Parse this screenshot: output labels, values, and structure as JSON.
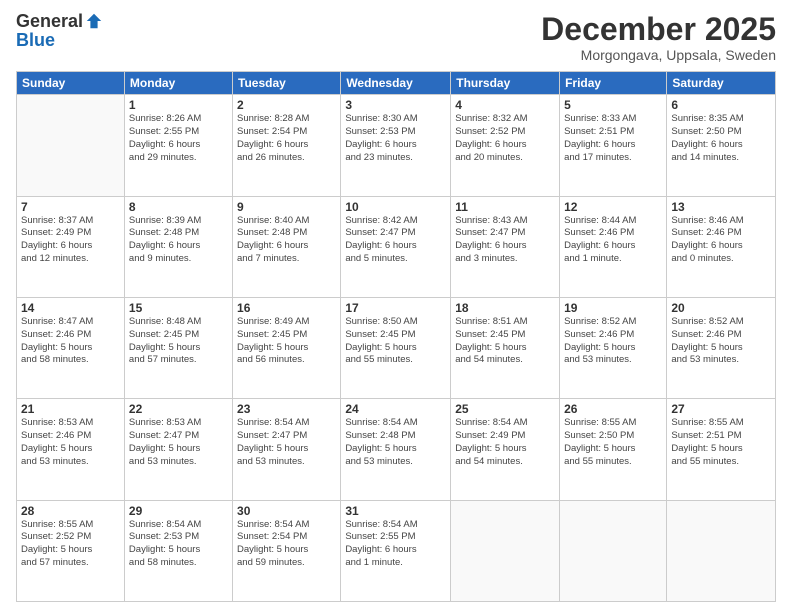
{
  "logo": {
    "general": "General",
    "blue": "Blue"
  },
  "title": "December 2025",
  "subtitle": "Morgongava, Uppsala, Sweden",
  "headers": [
    "Sunday",
    "Monday",
    "Tuesday",
    "Wednesday",
    "Thursday",
    "Friday",
    "Saturday"
  ],
  "weeks": [
    [
      {
        "day": "",
        "info": ""
      },
      {
        "day": "1",
        "info": "Sunrise: 8:26 AM\nSunset: 2:55 PM\nDaylight: 6 hours\nand 29 minutes."
      },
      {
        "day": "2",
        "info": "Sunrise: 8:28 AM\nSunset: 2:54 PM\nDaylight: 6 hours\nand 26 minutes."
      },
      {
        "day": "3",
        "info": "Sunrise: 8:30 AM\nSunset: 2:53 PM\nDaylight: 6 hours\nand 23 minutes."
      },
      {
        "day": "4",
        "info": "Sunrise: 8:32 AM\nSunset: 2:52 PM\nDaylight: 6 hours\nand 20 minutes."
      },
      {
        "day": "5",
        "info": "Sunrise: 8:33 AM\nSunset: 2:51 PM\nDaylight: 6 hours\nand 17 minutes."
      },
      {
        "day": "6",
        "info": "Sunrise: 8:35 AM\nSunset: 2:50 PM\nDaylight: 6 hours\nand 14 minutes."
      }
    ],
    [
      {
        "day": "7",
        "info": "Sunrise: 8:37 AM\nSunset: 2:49 PM\nDaylight: 6 hours\nand 12 minutes."
      },
      {
        "day": "8",
        "info": "Sunrise: 8:39 AM\nSunset: 2:48 PM\nDaylight: 6 hours\nand 9 minutes."
      },
      {
        "day": "9",
        "info": "Sunrise: 8:40 AM\nSunset: 2:48 PM\nDaylight: 6 hours\nand 7 minutes."
      },
      {
        "day": "10",
        "info": "Sunrise: 8:42 AM\nSunset: 2:47 PM\nDaylight: 6 hours\nand 5 minutes."
      },
      {
        "day": "11",
        "info": "Sunrise: 8:43 AM\nSunset: 2:47 PM\nDaylight: 6 hours\nand 3 minutes."
      },
      {
        "day": "12",
        "info": "Sunrise: 8:44 AM\nSunset: 2:46 PM\nDaylight: 6 hours\nand 1 minute."
      },
      {
        "day": "13",
        "info": "Sunrise: 8:46 AM\nSunset: 2:46 PM\nDaylight: 6 hours\nand 0 minutes."
      }
    ],
    [
      {
        "day": "14",
        "info": "Sunrise: 8:47 AM\nSunset: 2:46 PM\nDaylight: 5 hours\nand 58 minutes."
      },
      {
        "day": "15",
        "info": "Sunrise: 8:48 AM\nSunset: 2:45 PM\nDaylight: 5 hours\nand 57 minutes."
      },
      {
        "day": "16",
        "info": "Sunrise: 8:49 AM\nSunset: 2:45 PM\nDaylight: 5 hours\nand 56 minutes."
      },
      {
        "day": "17",
        "info": "Sunrise: 8:50 AM\nSunset: 2:45 PM\nDaylight: 5 hours\nand 55 minutes."
      },
      {
        "day": "18",
        "info": "Sunrise: 8:51 AM\nSunset: 2:45 PM\nDaylight: 5 hours\nand 54 minutes."
      },
      {
        "day": "19",
        "info": "Sunrise: 8:52 AM\nSunset: 2:46 PM\nDaylight: 5 hours\nand 53 minutes."
      },
      {
        "day": "20",
        "info": "Sunrise: 8:52 AM\nSunset: 2:46 PM\nDaylight: 5 hours\nand 53 minutes."
      }
    ],
    [
      {
        "day": "21",
        "info": "Sunrise: 8:53 AM\nSunset: 2:46 PM\nDaylight: 5 hours\nand 53 minutes."
      },
      {
        "day": "22",
        "info": "Sunrise: 8:53 AM\nSunset: 2:47 PM\nDaylight: 5 hours\nand 53 minutes."
      },
      {
        "day": "23",
        "info": "Sunrise: 8:54 AM\nSunset: 2:47 PM\nDaylight: 5 hours\nand 53 minutes."
      },
      {
        "day": "24",
        "info": "Sunrise: 8:54 AM\nSunset: 2:48 PM\nDaylight: 5 hours\nand 53 minutes."
      },
      {
        "day": "25",
        "info": "Sunrise: 8:54 AM\nSunset: 2:49 PM\nDaylight: 5 hours\nand 54 minutes."
      },
      {
        "day": "26",
        "info": "Sunrise: 8:55 AM\nSunset: 2:50 PM\nDaylight: 5 hours\nand 55 minutes."
      },
      {
        "day": "27",
        "info": "Sunrise: 8:55 AM\nSunset: 2:51 PM\nDaylight: 5 hours\nand 55 minutes."
      }
    ],
    [
      {
        "day": "28",
        "info": "Sunrise: 8:55 AM\nSunset: 2:52 PM\nDaylight: 5 hours\nand 57 minutes."
      },
      {
        "day": "29",
        "info": "Sunrise: 8:54 AM\nSunset: 2:53 PM\nDaylight: 5 hours\nand 58 minutes."
      },
      {
        "day": "30",
        "info": "Sunrise: 8:54 AM\nSunset: 2:54 PM\nDaylight: 5 hours\nand 59 minutes."
      },
      {
        "day": "31",
        "info": "Sunrise: 8:54 AM\nSunset: 2:55 PM\nDaylight: 6 hours\nand 1 minute."
      },
      {
        "day": "",
        "info": ""
      },
      {
        "day": "",
        "info": ""
      },
      {
        "day": "",
        "info": ""
      }
    ]
  ]
}
